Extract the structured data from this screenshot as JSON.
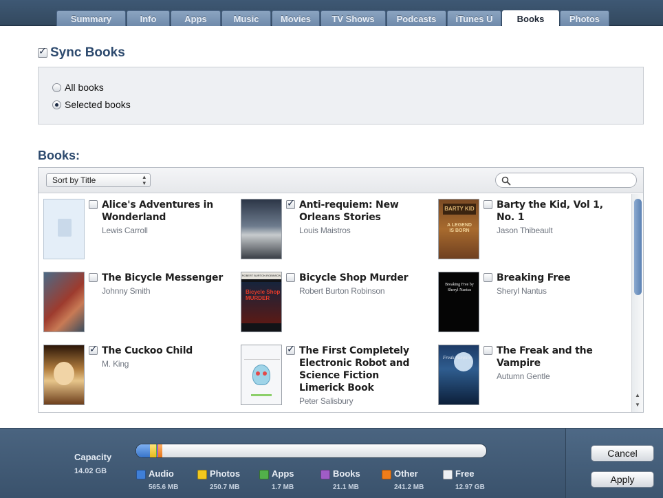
{
  "tabs": [
    {
      "label": "Summary",
      "active": false
    },
    {
      "label": "Info",
      "active": false
    },
    {
      "label": "Apps",
      "active": false
    },
    {
      "label": "Music",
      "active": false
    },
    {
      "label": "Movies",
      "active": false
    },
    {
      "label": "TV Shows",
      "active": false
    },
    {
      "label": "Podcasts",
      "active": false
    },
    {
      "label": "iTunes U",
      "active": false
    },
    {
      "label": "Books",
      "active": true
    },
    {
      "label": "Photos",
      "active": false
    }
  ],
  "sync": {
    "title": "Sync Books",
    "checked": true,
    "options": {
      "all": "All books",
      "selected": "Selected books"
    },
    "selected_option": "selected"
  },
  "books": {
    "heading": "Books:",
    "sort_label": "Sort by Title",
    "search_placeholder": "",
    "items": [
      {
        "title": "Alice's Adventures in Wonderland",
        "author": "Lewis Carroll",
        "checked": false
      },
      {
        "title": "Anti-requiem: New Orleans Stories",
        "author": "Louis Maistros",
        "checked": true
      },
      {
        "title": "Barty the Kid, Vol 1, No. 1",
        "author": "Jason Thibeault",
        "checked": false
      },
      {
        "title": "The Bicycle Messenger",
        "author": "Johnny Smith",
        "checked": false
      },
      {
        "title": "Bicycle Shop Murder",
        "author": "Robert Burton Robinson",
        "checked": false
      },
      {
        "title": "Breaking Free",
        "author": "Sheryl Nantus",
        "checked": false
      },
      {
        "title": "The Cuckoo Child",
        "author": "M. King",
        "checked": true
      },
      {
        "title": "The First Completely Electronic Robot and Science Fiction Limerick Book",
        "author": "Peter Salisbury",
        "checked": true
      },
      {
        "title": "The Freak and the Vampire",
        "author": "Autumn Gentle",
        "checked": false
      }
    ],
    "cover_text": {
      "barty_top": "BARTY KID",
      "barty_mid": "A LEGEND IS BORN",
      "murder_top": "ROBERT BURTON ROBINSON",
      "murder_title": "Bicycle Shop MURDER",
      "breaking": "Breaking Free by Sheryl Nantus",
      "freak": "Freak Vampire"
    }
  },
  "capacity": {
    "label": "Capacity",
    "total": "14.02 GB",
    "segments": [
      {
        "name": "Audio",
        "amount": "565.6 MB",
        "color": "#3f7fd8"
      },
      {
        "name": "Photos",
        "amount": "250.7 MB",
        "color": "#f2c81d"
      },
      {
        "name": "Apps",
        "amount": "1.7 MB",
        "color": "#52b04a"
      },
      {
        "name": "Books",
        "amount": "21.1 MB",
        "color": "#a05cc6"
      },
      {
        "name": "Other",
        "amount": "241.2 MB",
        "color": "#ef7d1a"
      },
      {
        "name": "Free",
        "amount": "12.97 GB",
        "color": "#eef0f3"
      }
    ]
  },
  "buttons": {
    "cancel": "Cancel",
    "apply": "Apply"
  }
}
